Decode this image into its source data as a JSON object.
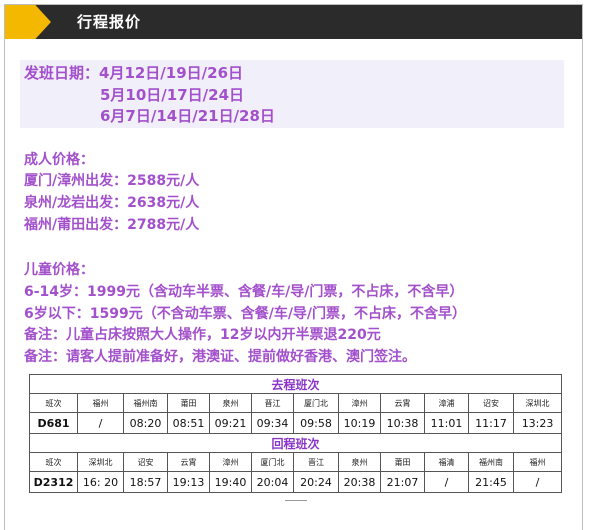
{
  "header": {
    "title": "行程报价"
  },
  "dates": {
    "label_line": "发班日期：4月12日/19日/26日",
    "line2": "5月10日/17日/24日",
    "line3": "6月7日/14日/21日/28日"
  },
  "adult": {
    "heading": "成人价格：",
    "lines": [
      "厦门/漳州出发：2588元/人",
      "泉州/龙岩出发：2638元/人",
      "福州/莆田出发：2788元/人"
    ]
  },
  "child": {
    "heading": "儿童价格：",
    "line1": "6-14岁：1999元（含动车半票、含餐/车/导/门票，不占床，不含早）",
    "line2": "6岁以下：1599元（不含动车票、含餐/车/导/门票，不占床，不含早）",
    "note1": "备注：儿童占床按照大人操作，12岁以内开半票退220元",
    "note2": "备注：请客人提前准备好，港澳证、提前做好香港、澳门签注。"
  },
  "outbound": {
    "title": "去程班次",
    "headers": [
      "班次",
      "福州",
      "福州南",
      "莆田",
      "泉州",
      "晋江",
      "厦门北",
      "漳州",
      "云霄",
      "漳浦",
      "诏安",
      "深圳北"
    ],
    "row": [
      "D681",
      "/",
      "08:20",
      "08:51",
      "09:21",
      "09:34",
      "09:58",
      "10:19",
      "10:38",
      "11:01",
      "11:17",
      "13:23"
    ]
  },
  "return": {
    "title": "回程班次",
    "headers": [
      "班次",
      "深圳北",
      "诏安",
      "云霄",
      "漳州",
      "厦门北",
      "晋江",
      "泉州",
      "莆田",
      "福清",
      "福州南",
      "福州"
    ],
    "row": [
      "D2312",
      "16: 20",
      "18:57",
      "19:13",
      "19:40",
      "20:04",
      "20:24",
      "20:38",
      "21:07",
      "/",
      "21:45",
      "/"
    ]
  },
  "colors": {
    "accent": "#a350cc",
    "header_bg": "#2b2b2b",
    "chevron": "#f5b800"
  }
}
